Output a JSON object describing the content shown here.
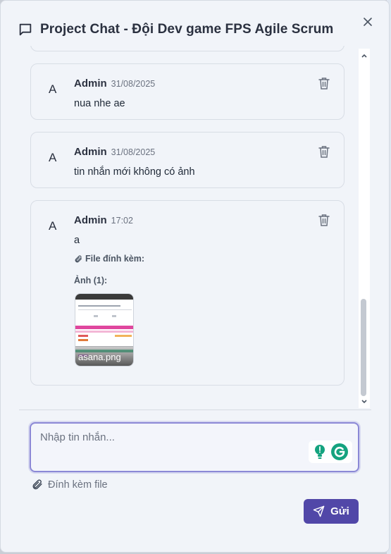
{
  "header": {
    "title": "Project Chat - Đội Dev game FPS Agile Scrum",
    "icon": "chat-bubble-icon"
  },
  "messages": [
    {
      "avatar": "A",
      "author": "Admin",
      "time": "31/08/2025",
      "text": "nua nhe ae"
    },
    {
      "avatar": "A",
      "author": "Admin",
      "time": "31/08/2025",
      "text": "tin nhắn mới không có ảnh"
    },
    {
      "avatar": "A",
      "author": "Admin",
      "time": "17:02",
      "text": "a",
      "attachments_label": "File đính kèm:",
      "images_label": "Ảnh (1):",
      "image_name": "asana.png"
    }
  ],
  "composer": {
    "placeholder": "Nhập tin nhắn...",
    "attach_label": "Đính kèm file",
    "send_label": "Gửi"
  },
  "colors": {
    "accent": "#5147a8",
    "focus_ring": "#8b88d6",
    "background": "#f1f4f9"
  }
}
